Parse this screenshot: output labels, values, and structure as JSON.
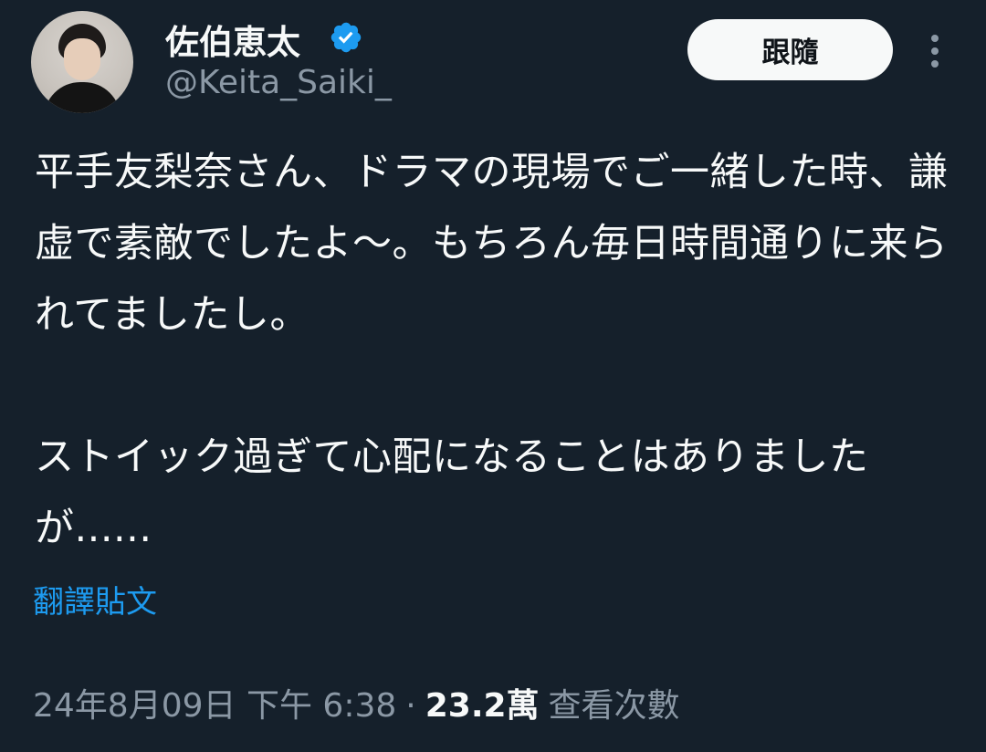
{
  "user": {
    "display_name": "佐伯恵太",
    "handle": "@Keita_Saiki_",
    "verified": true
  },
  "actions": {
    "follow_label": "跟隨",
    "more_icon": "more-vertical-icon"
  },
  "tweet": {
    "text": "平手友梨奈さん、ドラマの現場でご一緒した時、謙虚で素敵でしたよ〜。もちろん毎日時間通りに来られてましたし。\n\nストイック過ぎて心配になることはありましたが......",
    "translate_label": "翻譯貼文"
  },
  "meta": {
    "timestamp": "24年8月09日 下午 6:38",
    "separator": "·",
    "views_count": "23.2萬",
    "views_label": "查看次數"
  },
  "colors": {
    "background": "#15202b",
    "text_primary": "#f7f9f9",
    "text_secondary": "#8b98a5",
    "accent": "#1d9bf0"
  }
}
